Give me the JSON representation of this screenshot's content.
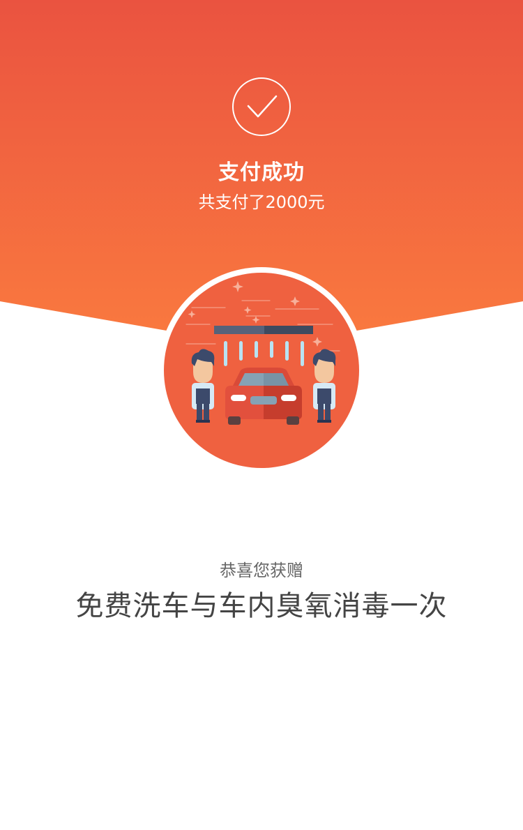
{
  "payment": {
    "status_title": "支付成功",
    "amount_text": "共支付了2000元"
  },
  "gift": {
    "label": "恭喜您获赠",
    "name": "免费洗车与车内臭氧消毒一次"
  },
  "icons": {
    "success": "check-icon",
    "illustration": "car-wash-illustration"
  },
  "colors": {
    "gradient_top": "#ea5340",
    "gradient_bottom": "#f9763f",
    "circle_fill": "#ef6140",
    "text_dark": "#444444",
    "text_muted": "#666666"
  }
}
